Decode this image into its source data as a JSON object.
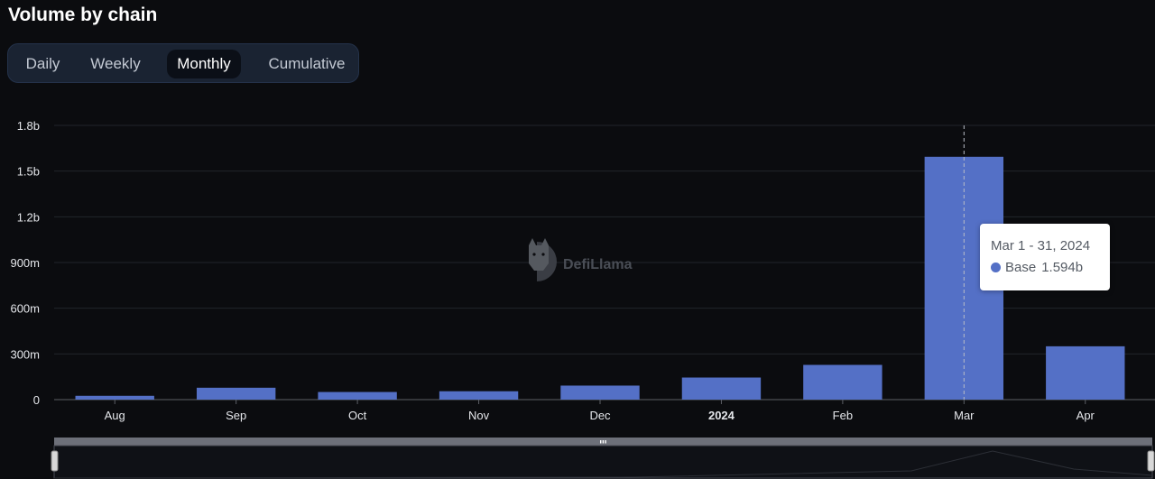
{
  "header": {
    "title": "Volume by chain"
  },
  "tabs": [
    {
      "label": "Daily",
      "active": false
    },
    {
      "label": "Weekly",
      "active": false
    },
    {
      "label": "Monthly",
      "active": true
    },
    {
      "label": "Cumulative",
      "active": false
    }
  ],
  "watermark": {
    "text": "DefiLlama"
  },
  "tooltip": {
    "date": "Mar 1 - 31, 2024",
    "series": "Base",
    "value": "1.594b",
    "color": "#5470c6"
  },
  "chart_data": {
    "type": "bar",
    "categories": [
      "Aug",
      "Sep",
      "Oct",
      "Nov",
      "Dec",
      "2024",
      "Feb",
      "Mar",
      "Apr"
    ],
    "series": [
      {
        "name": "Base",
        "color": "#5470c6",
        "values": [
          25000000,
          78000000,
          50000000,
          55000000,
          92000000,
          145000000,
          228000000,
          1594000000,
          350000000
        ]
      }
    ],
    "y_ticks": [
      "0",
      "300m",
      "600m",
      "900m",
      "1.2b",
      "1.5b",
      "1.8b"
    ],
    "ylim": [
      0,
      1800000000
    ],
    "bold_categories": [
      "2024"
    ],
    "highlight_category": "Mar",
    "grid": true
  }
}
